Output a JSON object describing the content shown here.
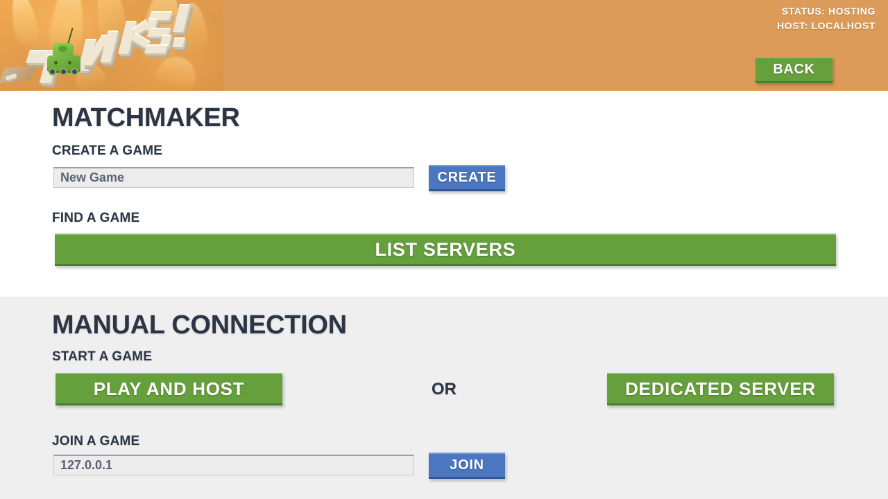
{
  "header": {
    "logo_alt": "TANKS!",
    "logo_word": "TANKS!",
    "status_line_1": "STATUS: HOSTING",
    "status_line_2": "HOST: LOCALHOST",
    "back_label": "BACK"
  },
  "matchmaker": {
    "title": "MATCHMAKER",
    "create_label": "CREATE A GAME",
    "game_name_value": "New Game",
    "game_name_placeholder": "New Game",
    "create_button": "CREATE",
    "find_label": "FIND A GAME",
    "list_servers_button": "LIST SERVERS"
  },
  "manual": {
    "title": "MANUAL CONNECTION",
    "start_label": "START A GAME",
    "play_and_host_button": "PLAY AND HOST",
    "or_text": "OR",
    "dedicated_server_button": "DEDICATED SERVER",
    "join_label": "JOIN A GAME",
    "address_value": "127.0.0.1",
    "address_placeholder": "127.0.0.1",
    "join_button": "JOIN"
  },
  "colors": {
    "header_orange": "#dc9b58",
    "green": "#66a03c",
    "blue": "#4a77c0",
    "text_dark": "#2b3544",
    "section_gray": "#efefef",
    "field_gray": "#ececec",
    "white": "#ffffff"
  }
}
